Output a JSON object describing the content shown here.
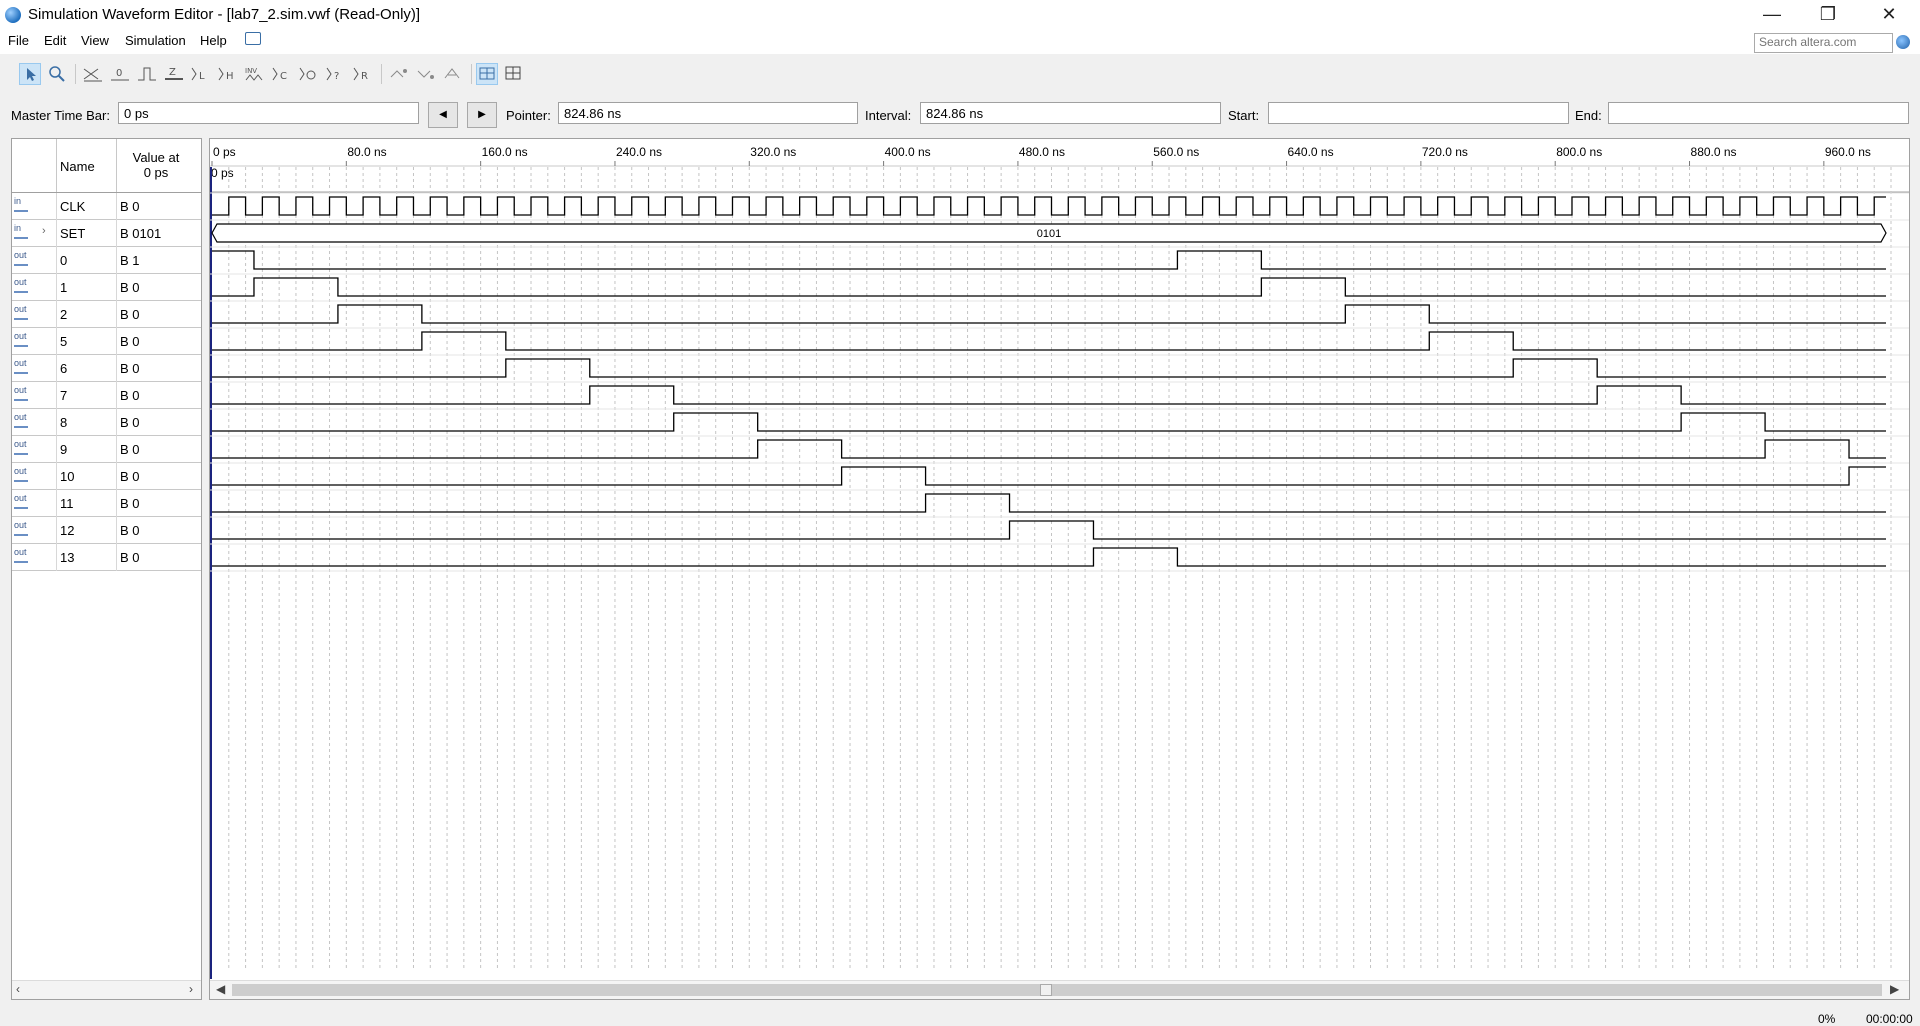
{
  "window": {
    "title": "Simulation Waveform Editor - [lab7_2.sim.vwf (Read-Only)]",
    "controls": [
      "minimize-icon",
      "restore-icon",
      "close-icon"
    ]
  },
  "menu": {
    "items": [
      "File",
      "Edit",
      "View",
      "Simulation",
      "Help"
    ],
    "search_placeholder": "Search altera.com"
  },
  "toolbar": {
    "tools": [
      "selection-tool-icon",
      "zoom-tool-icon",
      "forcing-unknown-icon",
      "forcing-low-icon",
      "forcing-high-icon",
      "high-impedance-icon",
      "weak-low-icon",
      "weak-high-icon",
      "invert-icon",
      "count-value-icon",
      "clock-value-icon",
      "random-value-icon",
      "arbitrary-value-icon",
      "snap-to-grid-icon",
      "grid-settings-icon"
    ]
  },
  "timebar": {
    "master_label": "Master Time Bar:",
    "master_value": "0 ps",
    "pointer_label": "Pointer:",
    "pointer_value": "824.86 ns",
    "interval_label": "Interval:",
    "interval_value": "824.86 ns",
    "start_label": "Start:",
    "start_value": "",
    "end_label": "End:",
    "end_value": ""
  },
  "table": {
    "name_header": "Name",
    "value_header_line1": "Value at",
    "value_header_line2": "0 ps"
  },
  "signals": [
    {
      "name": "CLK",
      "value": "B 0",
      "dir": "in"
    },
    {
      "name": "SET",
      "value": "B 0101",
      "dir": "in",
      "bus": true
    },
    {
      "name": "0",
      "value": "B 1",
      "dir": "out"
    },
    {
      "name": "1",
      "value": "B 0",
      "dir": "out"
    },
    {
      "name": "2",
      "value": "B 0",
      "dir": "out"
    },
    {
      "name": "5",
      "value": "B 0",
      "dir": "out"
    },
    {
      "name": "6",
      "value": "B 0",
      "dir": "out"
    },
    {
      "name": "7",
      "value": "B 0",
      "dir": "out"
    },
    {
      "name": "8",
      "value": "B 0",
      "dir": "out"
    },
    {
      "name": "9",
      "value": "B 0",
      "dir": "out"
    },
    {
      "name": "10",
      "value": "B 0",
      "dir": "out"
    },
    {
      "name": "11",
      "value": "B 0",
      "dir": "out"
    },
    {
      "name": "12",
      "value": "B 0",
      "dir": "out"
    },
    {
      "name": "13",
      "value": "B 0",
      "dir": "out"
    }
  ],
  "waveform": {
    "time_ticks": [
      "0 ps",
      "80.0 ns",
      "160.0 ns",
      "240.0 ns",
      "320.0 ns",
      "400.0 ns",
      "480.0 ns",
      "560.0 ns",
      "640.0 ns",
      "720.0 ns",
      "800.0 ns",
      "880.0 ns",
      "960.0 ns"
    ],
    "tick_step_ns": 80,
    "master_marker_label": "0 ps",
    "visible_end_ns": 1000,
    "clock_period_ns": 20,
    "bus_value_label": "0101",
    "pulses_ns": [
      [
        [
          0,
          25
        ],
        [
          575,
          625
        ]
      ],
      [
        [
          25,
          75
        ],
        [
          625,
          675
        ]
      ],
      [
        [
          75,
          125
        ],
        [
          675,
          725
        ]
      ],
      [
        [
          125,
          175
        ],
        [
          725,
          775
        ]
      ],
      [
        [
          175,
          225
        ],
        [
          775,
          825
        ]
      ],
      [
        [
          225,
          275
        ],
        [
          825,
          875
        ]
      ],
      [
        [
          275,
          325
        ],
        [
          875,
          925
        ]
      ],
      [
        [
          325,
          375
        ],
        [
          925,
          975
        ]
      ],
      [
        [
          375,
          425
        ],
        [
          975,
          1000
        ]
      ],
      [
        [
          425,
          475
        ]
      ],
      [
        [
          475,
          525
        ]
      ],
      [
        [
          525,
          575
        ]
      ]
    ]
  },
  "status": {
    "progress": "0%",
    "elapsed": "00:00:00"
  }
}
